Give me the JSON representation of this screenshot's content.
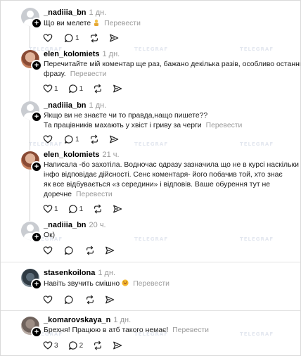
{
  "ui": {
    "translate_label": "Перевести",
    "watermark": "TELEGRAF"
  },
  "posts": [
    {
      "username": "_nadiiia_bn",
      "time": "1 дн.",
      "lines": [
        "Що ви мелете"
      ],
      "emoji": "person-emoji",
      "likes": "",
      "replies": "1",
      "avatar": "default-gray"
    },
    {
      "username": "elen_kolomiets",
      "time": "1 дн.",
      "lines": [
        "Перечитайте мій коментар ще раз, бажано декілька разів, особливо останню",
        "фразу."
      ],
      "likes": "1",
      "replies": "1",
      "avatar": "photo"
    },
    {
      "username": "_nadiiia_bn",
      "time": "1 дн.",
      "lines": [
        "Якщо ви не знаєте чи то правда,нащо пишете??",
        "Та працівників махають у хвіст і гриву за черги"
      ],
      "likes": "",
      "replies": "1",
      "avatar": "default-gray"
    },
    {
      "username": "elen_kolomiets",
      "time": "21 ч.",
      "lines": [
        "Написала -бо захотіла. Водночас одразу зазначила що не в курсі наскільки",
        "інфо відповідає дійсності. Сенс коментаря- його побачив той, хто знає",
        "як все відбувається «з середини» і відповів. Ваше обурення тут не",
        "доречне"
      ],
      "likes": "1",
      "replies": "1",
      "avatar": "photo"
    },
    {
      "username": "_nadiiia_bn",
      "time": "20 ч.",
      "lines": [
        "Ок)"
      ],
      "likes": "",
      "replies": "",
      "avatar": "default-gray"
    },
    {
      "username": "stasenkoilona",
      "time": "1 дн.",
      "lines": [
        "Навіть звучить смішно"
      ],
      "emoji": "laughing-emoji",
      "likes": "",
      "replies": "",
      "avatar": "photo"
    },
    {
      "username": "_komarovskaya_n",
      "time": "1 дн.",
      "lines": [
        "Брехня! Працюю в атб такого немає!"
      ],
      "likes": "3",
      "replies": "2",
      "avatar": "photo"
    }
  ]
}
